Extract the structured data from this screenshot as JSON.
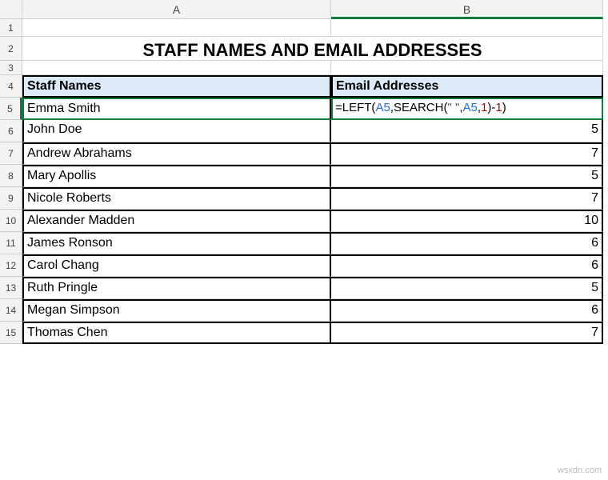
{
  "columns": {
    "A": "A",
    "B": "B"
  },
  "title": "STAFF NAMES AND EMAIL ADDRESSES",
  "headers": {
    "staff": "Staff Names",
    "email": "Email Addresses"
  },
  "active_formula": {
    "parts": [
      {
        "t": "=LEFT(",
        "cls": "fn"
      },
      {
        "t": "A5",
        "cls": "ref"
      },
      {
        "t": ",SEARCH(",
        "cls": "fn"
      },
      {
        "t": "\" \"",
        "cls": "str-lit"
      },
      {
        "t": ",",
        "cls": "fn"
      },
      {
        "t": "A5",
        "cls": "ref"
      },
      {
        "t": ",",
        "cls": "fn"
      },
      {
        "t": "1",
        "cls": "num-lit"
      },
      {
        "t": ")-",
        "cls": "fn"
      },
      {
        "t": "1",
        "cls": "num-lit"
      },
      {
        "t": ")",
        "cls": "fn"
      }
    ]
  },
  "rows": [
    {
      "n": "5",
      "name": "Emma Smith",
      "val": null
    },
    {
      "n": "6",
      "name": "John Doe",
      "val": "5"
    },
    {
      "n": "7",
      "name": "Andrew Abrahams",
      "val": "7"
    },
    {
      "n": "8",
      "name": "Mary Apollis",
      "val": "5"
    },
    {
      "n": "9",
      "name": "Nicole Roberts",
      "val": "7"
    },
    {
      "n": "10",
      "name": "Alexander Madden",
      "val": "10"
    },
    {
      "n": "11",
      "name": "James Ronson",
      "val": "6"
    },
    {
      "n": "12",
      "name": "Carol Chang",
      "val": "6"
    },
    {
      "n": "13",
      "name": "Ruth Pringle",
      "val": "5"
    },
    {
      "n": "14",
      "name": "Megan Simpson",
      "val": "6"
    },
    {
      "n": "15",
      "name": "Thomas Chen",
      "val": "7"
    }
  ],
  "rowNums": {
    "r1": "1",
    "r2": "2",
    "r3": "3",
    "r4": "4"
  },
  "watermark": "wsxdn.com"
}
